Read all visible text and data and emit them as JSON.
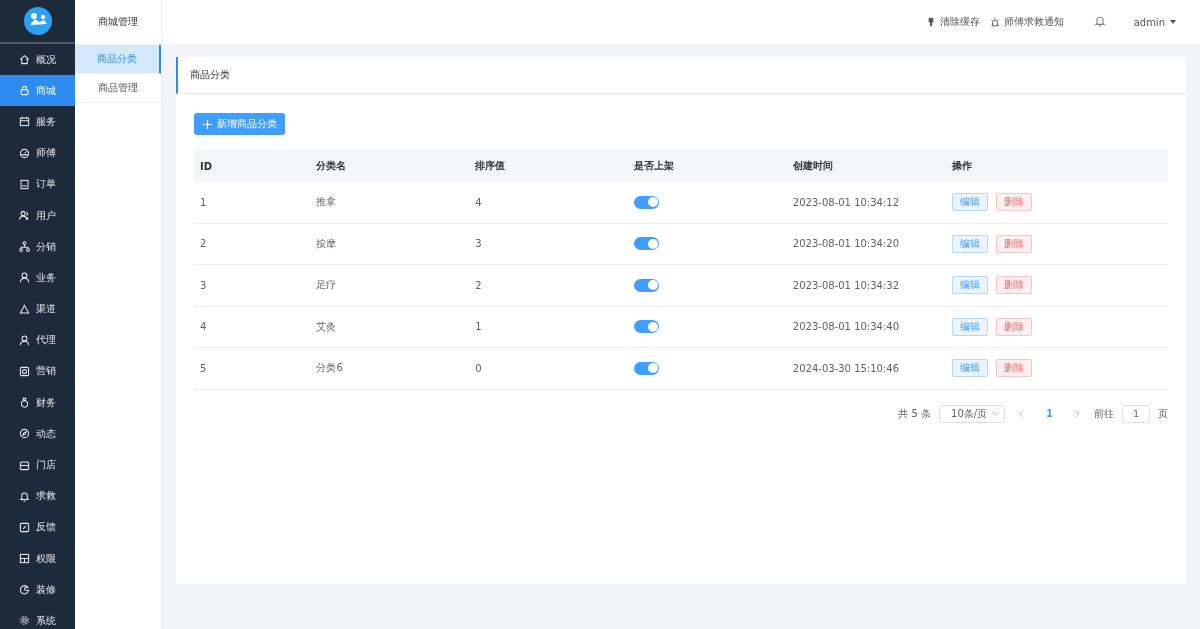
{
  "sidebar": {
    "items": [
      {
        "label": "概况",
        "selected": false
      },
      {
        "label": "商城",
        "selected": true
      },
      {
        "label": "服务",
        "selected": false
      },
      {
        "label": "师傅",
        "selected": false
      },
      {
        "label": "订单",
        "selected": false
      },
      {
        "label": "用户",
        "selected": false
      },
      {
        "label": "分销",
        "selected": false
      },
      {
        "label": "业务",
        "selected": false
      },
      {
        "label": "渠道",
        "selected": false
      },
      {
        "label": "代理",
        "selected": false
      },
      {
        "label": "营销",
        "selected": false
      },
      {
        "label": "财务",
        "selected": false
      },
      {
        "label": "动态",
        "selected": false
      },
      {
        "label": "门店",
        "selected": false
      },
      {
        "label": "求救",
        "selected": false
      },
      {
        "label": "反馈",
        "selected": false
      },
      {
        "label": "权限",
        "selected": false
      },
      {
        "label": "装修",
        "selected": false
      },
      {
        "label": "系统",
        "selected": false
      }
    ]
  },
  "submenu": {
    "title": "商城管理",
    "items": [
      {
        "label": "商品分类",
        "selected": true
      },
      {
        "label": "商品管理",
        "selected": false
      }
    ]
  },
  "topbar": {
    "links": [
      "清除缓存",
      "师傅求救通知"
    ],
    "user": "admin"
  },
  "card": {
    "title": "商品分类",
    "add_button": "新增商品分类"
  },
  "table": {
    "columns": [
      "ID",
      "分类名",
      "排序值",
      "是否上架",
      "创建时间",
      "操作"
    ],
    "rows": [
      {
        "id": "1",
        "name": "推拿",
        "sort": "4",
        "on": true,
        "created": "2023-08-01 10:34:12",
        "actions": [
          {
            "label": "编辑",
            "kind": "edit"
          },
          {
            "label": "删除",
            "kind": "delete"
          }
        ]
      },
      {
        "id": "2",
        "name": "按摩",
        "sort": "3",
        "on": true,
        "created": "2023-08-01 10:34:20",
        "actions": [
          {
            "label": "编辑",
            "kind": "edit"
          },
          {
            "label": "删除",
            "kind": "delete"
          }
        ]
      },
      {
        "id": "3",
        "name": "足疗",
        "sort": "2",
        "on": true,
        "created": "2023-08-01 10:34:32",
        "actions": [
          {
            "label": "编辑",
            "kind": "edit"
          },
          {
            "label": "删除",
            "kind": "delete"
          }
        ]
      },
      {
        "id": "4",
        "name": "艾灸",
        "sort": "1",
        "on": true,
        "created": "2023-08-01 10:34:40",
        "actions": [
          {
            "label": "编辑",
            "kind": "edit"
          },
          {
            "label": "删除",
            "kind": "delete"
          }
        ]
      },
      {
        "id": "5",
        "name": "分类6",
        "sort": "0",
        "on": true,
        "created": "2024-03-30 15:10:46",
        "actions": [
          {
            "label": "编辑",
            "kind": "edit"
          },
          {
            "label": "删除",
            "kind": "delete"
          }
        ]
      }
    ]
  },
  "pagination": {
    "total": "共 5 条",
    "page_size": "10条/页",
    "pages": [
      {
        "label": "1",
        "selected": true
      }
    ],
    "goto_label": "前往",
    "goto_value": "1",
    "goto_suffix": "页"
  }
}
